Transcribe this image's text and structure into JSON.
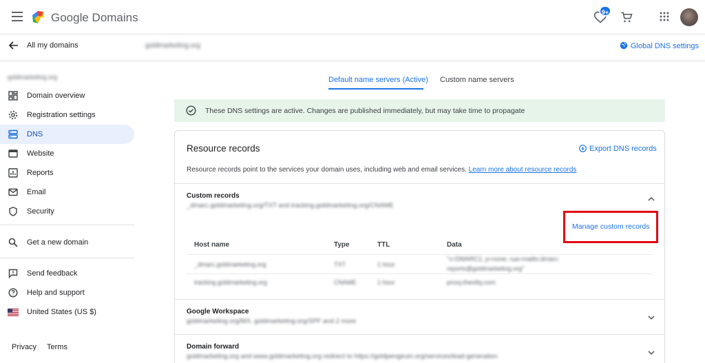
{
  "app": {
    "brand": "Google Domains",
    "badge": "9+"
  },
  "header": {
    "back_label": "All my domains",
    "domain": "goldmarketing.org",
    "global_dns_label": "Global DNS settings"
  },
  "sidebar": {
    "domain": "goldmarketing.org",
    "items": [
      {
        "label": "Domain overview",
        "icon": "overview-icon"
      },
      {
        "label": "Registration settings",
        "icon": "gear-icon"
      },
      {
        "label": "DNS",
        "icon": "dns-icon",
        "active": true
      },
      {
        "label": "Website",
        "icon": "website-icon"
      },
      {
        "label": "Reports",
        "icon": "reports-icon"
      },
      {
        "label": "Email",
        "icon": "email-icon"
      },
      {
        "label": "Security",
        "icon": "shield-icon"
      }
    ],
    "get_domain": "Get a new domain",
    "bottom": [
      {
        "label": "Send feedback",
        "icon": "feedback-icon"
      },
      {
        "label": "Help and support",
        "icon": "help-icon"
      },
      {
        "label": "United States (US $)",
        "icon": "us-flag-icon"
      }
    ],
    "footer": {
      "privacy": "Privacy",
      "terms": "Terms"
    }
  },
  "tabs": [
    {
      "label": "Default name servers (Active)",
      "active": true
    },
    {
      "label": "Custom name servers",
      "active": false
    }
  ],
  "alert": {
    "text": "These DNS settings are active. Changes are published immediately, but may take time to propagate"
  },
  "resource_records": {
    "title": "Resource records",
    "export_label": "Export DNS records",
    "description": "Resource records point to the services your domain uses, including web and email services.",
    "learn_more": "Learn more about resource records",
    "custom": {
      "title": "Custom records",
      "subtitle": "_dmarc.goldmarketing.org/TXT and tracking.goldmarketing.org/CNAME",
      "manage_label": "Manage custom records",
      "columns": [
        "Host name",
        "Type",
        "TTL",
        "Data"
      ],
      "rows": [
        {
          "host": "_dmarc.goldmarketing.org",
          "type": "TXT",
          "ttl": "1 hour",
          "data": [
            "\"v=DMARC1; p=none; rua=mailto:dmarc-",
            "reports@goldmarketing.org\""
          ]
        },
        {
          "host": "tracking.goldmarketing.org",
          "type": "CNAME",
          "ttl": "1 hour",
          "data": [
            "proxy.thexlity.com"
          ]
        }
      ]
    },
    "workspace": {
      "title": "Google Workspace",
      "subtitle": "goldmarketing.org/MX, goldmarketing.org/SPF and 2 more"
    },
    "forward": {
      "title": "Domain forward",
      "subtitle": "goldmarketing.org and www.goldmarketing.org redirect to https://goldpengeuin.org/services/lead-generation"
    }
  },
  "colors": {
    "accent": "#1a73e8",
    "active_nav_bg": "#e8f0fe",
    "alert_bg": "#e6f4ea",
    "highlight": "#e30613"
  }
}
